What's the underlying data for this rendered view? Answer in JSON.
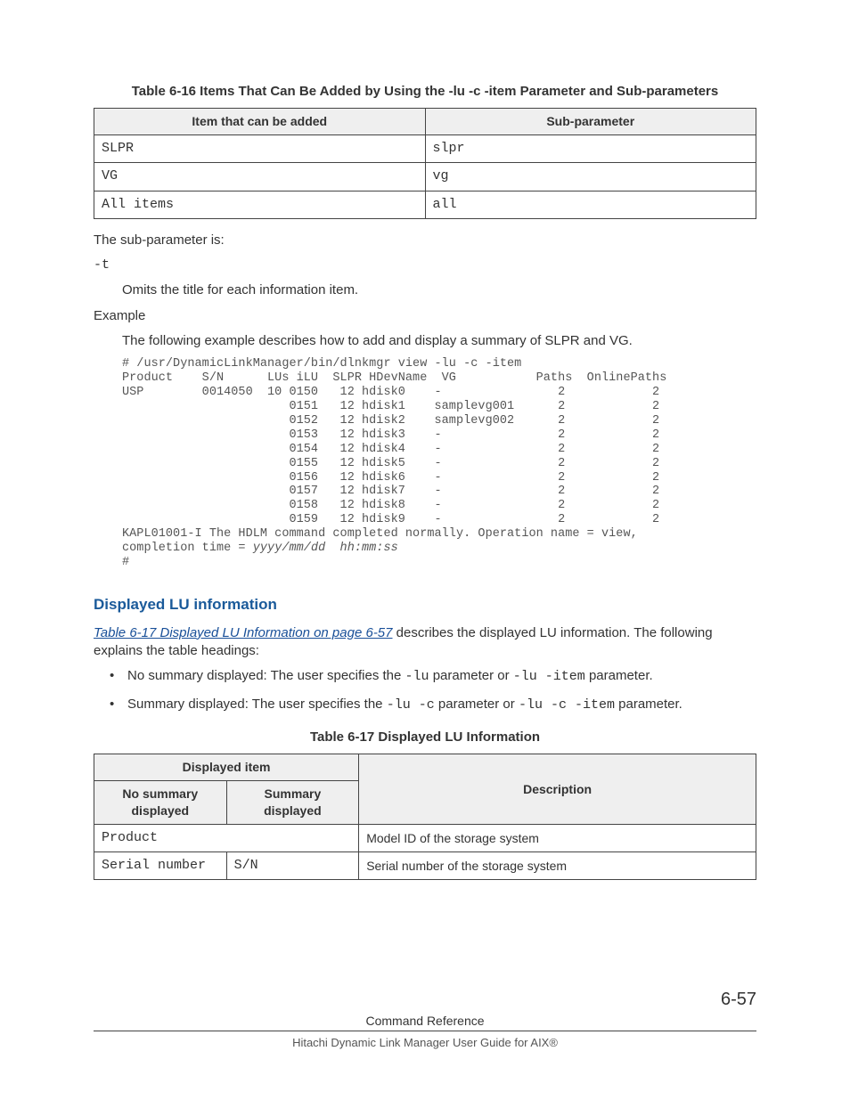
{
  "table616": {
    "caption": "Table 6-16 Items That Can Be Added by Using the -lu -c -item Parameter and Sub-parameters",
    "headers": {
      "c1": "Item that can be added",
      "c2": "Sub-parameter"
    },
    "rows": [
      {
        "item": "SLPR",
        "sub": "slpr"
      },
      {
        "item": "VG",
        "sub": "vg"
      },
      {
        "item": "All items",
        "sub": "all"
      }
    ]
  },
  "subparam_intro": "The sub-parameter is:",
  "subparam_t": "-t",
  "subparam_t_desc": "Omits the title for each information item.",
  "example_label": "Example",
  "example_desc": "The following example describes how to add and display a summary of SLPR and VG.",
  "code": {
    "l1": "# /usr/DynamicLinkManager/bin/dlnkmgr view -lu -c -item",
    "l2": "Product    S/N      LUs iLU  SLPR HDevName  VG           Paths  OnlinePaths",
    "l3": "USP        0014050  10 0150   12 hdisk0    -                2            2",
    "l4": "                       0151   12 hdisk1    samplevg001      2            2",
    "l5": "                       0152   12 hdisk2    samplevg002      2            2",
    "l6": "                       0153   12 hdisk3    -                2            2",
    "l7": "                       0154   12 hdisk4    -                2            2",
    "l8": "                       0155   12 hdisk5    -                2            2",
    "l9": "                       0156   12 hdisk6    -                2            2",
    "l10": "                       0157   12 hdisk7    -                2            2",
    "l11": "                       0158   12 hdisk8    -                2            2",
    "l12": "                       0159   12 hdisk9    -                2            2",
    "l13": "KAPL01001-I The HDLM command completed normally. Operation name = view,",
    "l14a": "completion time = ",
    "l14b": "yyyy/mm/dd  hh:mm:ss",
    "l15": "#"
  },
  "section_heading": "Displayed LU information",
  "xref_text": "Table 6-17 Displayed LU Information on page 6-57",
  "xref_followup": " describes the displayed LU information. The following explains the table headings:",
  "bullets": {
    "b1_a": "No summary displayed: The user specifies the ",
    "b1_c1": "-lu",
    "b1_b": " parameter or ",
    "b1_c2": "-lu -item",
    "b1_c": " parameter.",
    "b2_a": "Summary displayed: The user specifies the ",
    "b2_c1": "-lu -c",
    "b2_b": " parameter or ",
    "b2_c2": "-lu -c -item",
    "b2_c": " parameter."
  },
  "table617": {
    "caption": "Table 6-17 Displayed LU Information",
    "headers": {
      "disp_item": "Displayed item",
      "no_sum": "No summary displayed",
      "sum": "Summary displayed",
      "desc": "Description"
    },
    "rows": [
      {
        "c1": "Product",
        "c2": "",
        "desc": "Model ID of the storage system",
        "span": true
      },
      {
        "c1": "Serial number",
        "c2": "S/N",
        "desc": "Serial number of the storage system",
        "span": false
      }
    ]
  },
  "footer": {
    "cmdref": "Command Reference",
    "pageno": "6-57",
    "book": "Hitachi Dynamic Link Manager User Guide for AIX®"
  }
}
